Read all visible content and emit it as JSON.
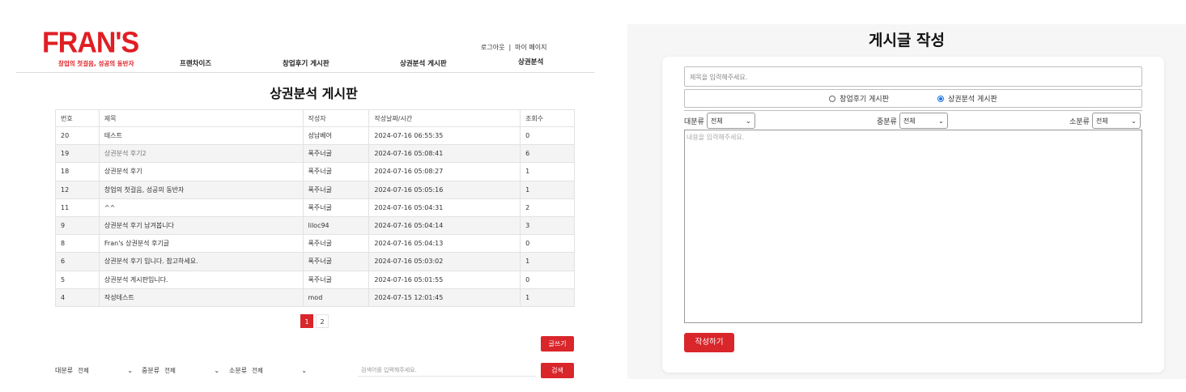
{
  "left": {
    "logo": {
      "main": "FRAN'S",
      "sub": "창업의 첫걸음, 성공의 동반자"
    },
    "user_links": {
      "logout": "로그아웃",
      "separator": "|",
      "mypage": "마이 페이지"
    },
    "nav": [
      "프랜차이즈",
      "창업후기 게시판",
      "상권분석 게시판",
      "상권분석"
    ],
    "board_title": "상권분석 게시판",
    "table": {
      "headers": [
        "번호",
        "제목",
        "작성자",
        "작성날짜/시간",
        "조회수"
      ],
      "rows": [
        {
          "no": "20",
          "title": "테스트",
          "author": "성남베어",
          "date": "2024-07-16 06:55:35",
          "views": "0"
        },
        {
          "no": "19",
          "title": "상권분석 후기2",
          "author": "폭주너굴",
          "date": "2024-07-16 05:08:41",
          "views": "6"
        },
        {
          "no": "18",
          "title": "상권분석 후기",
          "author": "폭주너굴",
          "date": "2024-07-16 05:08:27",
          "views": "1"
        },
        {
          "no": "12",
          "title": "창업의 첫걸음, 성공의 동반자",
          "author": "폭주너굴",
          "date": "2024-07-16 05:05:16",
          "views": "1"
        },
        {
          "no": "11",
          "title": "^^",
          "author": "폭주너굴",
          "date": "2024-07-16 05:04:31",
          "views": "2"
        },
        {
          "no": "9",
          "title": "상권분석 후기 남겨봅니다",
          "author": "liloc94",
          "date": "2024-07-16 05:04:14",
          "views": "3"
        },
        {
          "no": "8",
          "title": "Fran's 상권분석 후기글",
          "author": "폭주너굴",
          "date": "2024-07-16 05:04:13",
          "views": "0"
        },
        {
          "no": "6",
          "title": "상권분석 후기 입니다. 참고하세요.",
          "author": "폭주너굴",
          "date": "2024-07-16 05:03:02",
          "views": "1"
        },
        {
          "no": "5",
          "title": "상권분석 게시판입니다.",
          "author": "폭주너굴",
          "date": "2024-07-16 05:01:55",
          "views": "0"
        },
        {
          "no": "4",
          "title": "작성테스트",
          "author": "mod",
          "date": "2024-07-15 12:01:45",
          "views": "1"
        }
      ]
    },
    "pagination": [
      "1",
      "2"
    ],
    "current_page": "1",
    "write_button": "글쓰기",
    "filters": [
      {
        "label": "대분류",
        "value": "전체"
      },
      {
        "label": "중분류",
        "value": "전체"
      },
      {
        "label": "소분류",
        "value": "전체"
      }
    ],
    "search_placeholder": "검색어를 입력해주세요.",
    "search_button": "검색"
  },
  "right": {
    "title": "게시글 작성",
    "title_placeholder": "제목을 입력해주세요.",
    "radio_options": [
      {
        "label": "창업후기 게시판",
        "checked": false
      },
      {
        "label": "상권분석 게시판",
        "checked": true
      }
    ],
    "categories": [
      {
        "label": "대분류",
        "value": "전체"
      },
      {
        "label": "중분류",
        "value": "전체"
      },
      {
        "label": "소분류",
        "value": "전체"
      }
    ],
    "content_placeholder": "내용을 입력해주세요.",
    "submit_button": "작성하기"
  },
  "colors": {
    "brand_red": "#d9262b",
    "logo_red": "#e01e24",
    "radio_blue": "#1a73e8"
  }
}
